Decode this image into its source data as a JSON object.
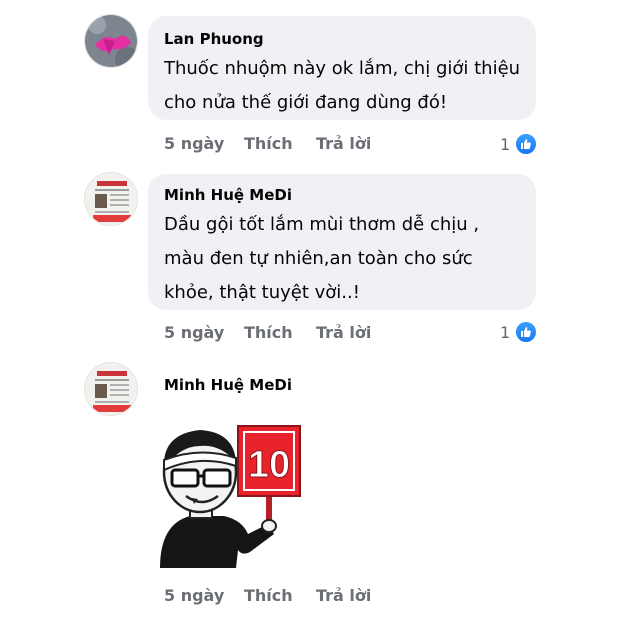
{
  "comments": [
    {
      "author": "Lan Phuong",
      "text": "Thuốc nhuộm này ok lắm, chị giới thiệu cho nửa thế giới đang dùng đó!",
      "time": "5 ngày",
      "like_label": "Thích",
      "reply_label": "Trả lời",
      "reaction_count": "1",
      "avatar_icon": "pink-cloth-photo-icon"
    },
    {
      "author": "Minh Huệ MeDi",
      "text": "Dầu gội tốt lắm mùi thơm dễ chịu , màu đen tự nhiên,an toàn cho sức khỏe, thật tuyệt vời..!",
      "time": "5 ngày",
      "like_label": "Thích",
      "reply_label": "Trả lời",
      "reaction_count": "1",
      "avatar_icon": "newspaper-photo-icon"
    },
    {
      "author": "Minh Huệ MeDi",
      "sticker": "score-ten-sign-sticker",
      "sticker_sign": "10",
      "time": "5 ngày",
      "like_label": "Thích",
      "reply_label": "Trả lời",
      "avatar_icon": "newspaper-photo-icon"
    }
  ],
  "colors": {
    "bubble": "#eff1f4",
    "like_blue": "#1877f2",
    "sign_red": "#e8232b"
  }
}
